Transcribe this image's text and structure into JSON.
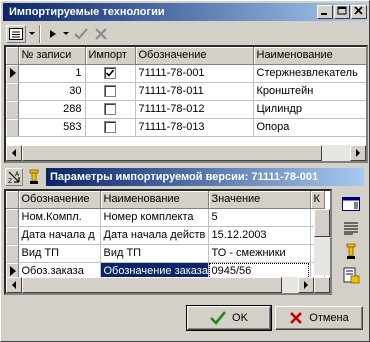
{
  "window": {
    "title": "Импортируемые технологии"
  },
  "top_grid": {
    "columns": [
      "№ записи",
      "Импорт",
      "Обозначение",
      "Наименование"
    ],
    "rows": [
      {
        "num": "1",
        "checked": true,
        "code": "71111-78-001",
        "name": "Стержнезвлекатель"
      },
      {
        "num": "30",
        "checked": false,
        "code": "71111-78-011",
        "name": "Кронштейн"
      },
      {
        "num": "288",
        "checked": false,
        "code": "71111-78-012",
        "name": "Цилиндр"
      },
      {
        "num": "583",
        "checked": false,
        "code": "71111-78-013",
        "name": "Опора"
      }
    ]
  },
  "params_section": {
    "title": "Параметры импортируемой версии: 71111-78-001"
  },
  "params_grid": {
    "columns": [
      "Обозначение",
      "Наименование",
      "Значение",
      "К"
    ],
    "rows": [
      {
        "code": "Ном.Компл.",
        "name": "Номер комплекта",
        "value": "5"
      },
      {
        "code": "Дата начала д",
        "name": "Дата начала действ",
        "value": "15.12.2003"
      },
      {
        "code": "Вид ТП",
        "name": "Вид ТП",
        "value": "ТО - смежники"
      },
      {
        "code": "Обоз.заказа",
        "name": "Обозначение заказа",
        "value": "0945/56"
      }
    ]
  },
  "buttons": {
    "ok": "OK",
    "cancel": "Отмена"
  },
  "colors": {
    "title_start": "#0a246a",
    "title_end": "#a6caf0",
    "ok_check": "#1a8a1a",
    "cancel_x": "#c00000"
  }
}
